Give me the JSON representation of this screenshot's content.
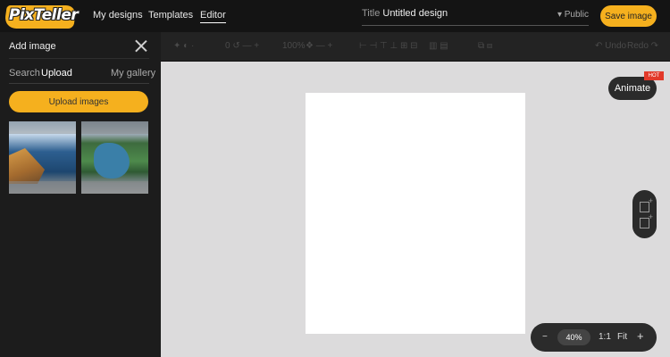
{
  "app": {
    "logo_text": "PixTeller"
  },
  "nav": {
    "my_designs": "My designs",
    "templates": "Templates",
    "editor": "Editor"
  },
  "title_field": {
    "label": "Title",
    "value": "Untitled design"
  },
  "visibility": "▾ Public",
  "save_button": "Save image",
  "toolbar": {
    "undo": "Undo",
    "redo": "Redo",
    "zoom_pct": "100%"
  },
  "panel": {
    "title": "Add image",
    "tabs": [
      "Search",
      "Upload",
      "My gallery"
    ],
    "active_tab": "Upload",
    "upload_button": "Upload images",
    "thumbnails": [
      "coastal-cliff-photo",
      "river-aerial-photo"
    ]
  },
  "animate": {
    "label": "Animate",
    "badge": "HOT"
  },
  "zoom": {
    "minus": "−",
    "value": "40%",
    "one_to_one": "1:1",
    "fit": "Fit",
    "plus": "+"
  },
  "colors": {
    "accent": "#f5b01e",
    "topbar": "#141414",
    "panel": "#1c1c1c",
    "workspace": "#dcdbdc",
    "hot": "#e23a2a"
  }
}
